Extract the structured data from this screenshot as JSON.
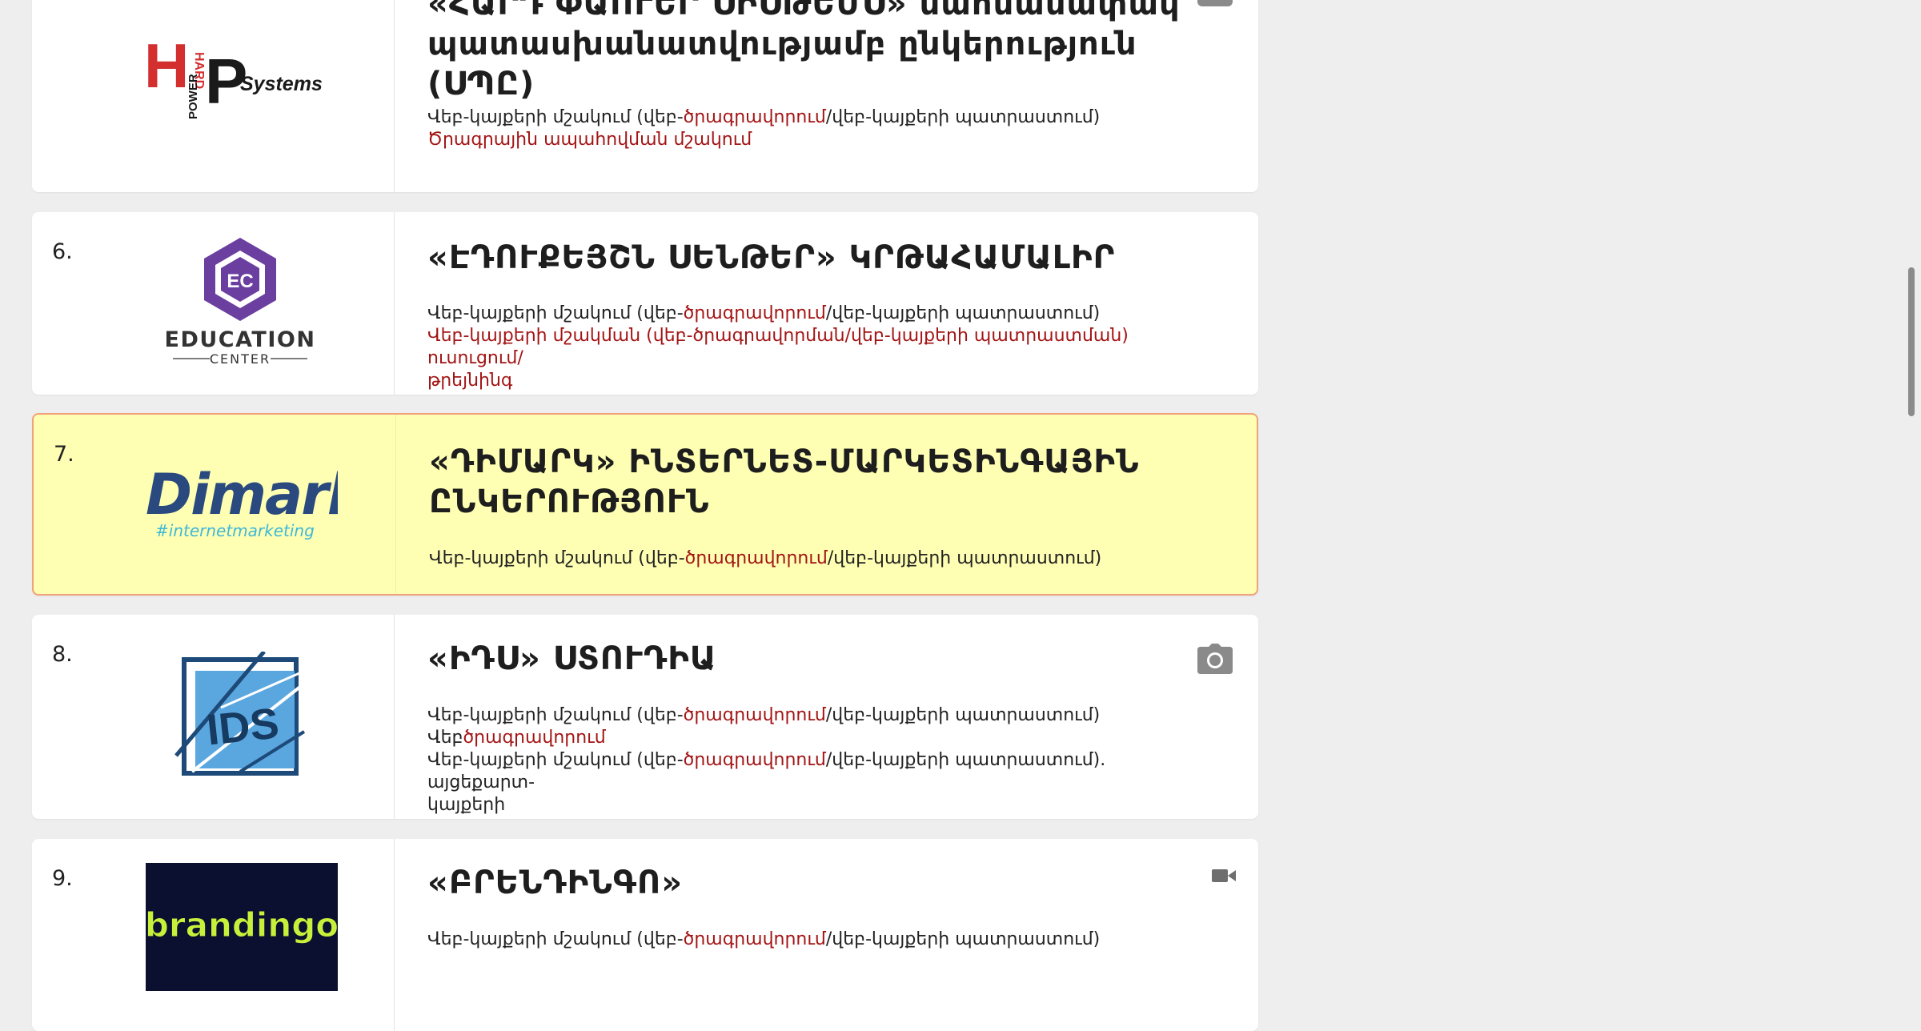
{
  "items": [
    {
      "title_lines": [
        "«ՀԱՐԴ ՓԱՈՒԵՐ ՍԻՍԹԵՄՍ» սահմանափակ",
        "պատասխանատվությամբ ընկերություն",
        "(ՍՊԸ)"
      ],
      "logo_text": {
        "h": "H",
        "hard": "HARD",
        "power": "POWER",
        "p": "P",
        "systems": "Systems"
      },
      "desc": {
        "l1a": "Վեբ-կայքերի մշակում (վեբ-",
        "l1b": "ծրագրավորում",
        "l1c": "/վեբ-կայքերի պատրաստում)",
        "l2": "Ծրագրային ապահովման մշակում"
      }
    },
    {
      "number": "6.",
      "title_lines": [
        "«ԷԴՈՒՔԵՅՇՆ ՍԵՆԹԵՐ» ԿՐԹԱՀԱՄԱԼԻՐ"
      ],
      "logo_text": {
        "ec": "EC",
        "education": "EDUCATION",
        "center": "CENTER"
      },
      "desc": {
        "l1a": "Վեբ-կայքերի մշակում (վեբ-",
        "l1b": "ծրագրավորում",
        "l1c": "/վեբ-կայքերի պատրաստում)",
        "l2": "Վեբ-կայքերի մշակման (վեբ-ծրագրավորման/վեբ-կայքերի պատրաստման) ուսուցում/",
        "l3": "թրեյնինգ"
      }
    },
    {
      "number": "7.",
      "title_lines": [
        "«ԴԻՄԱՐԿ» ԻՆՏԵՐՆԵՏ-ՄԱՐԿԵՏԻՆԳԱՅԻՆ",
        "ԸՆԿԵՐՈՒԹՅՈՒՆ"
      ],
      "logo_text": {
        "dimark": "Dimark",
        "tag": "#internetmarketing"
      },
      "desc": {
        "l1a": "Վեբ-կայքերի մշակում (վեբ-",
        "l1b": "ծրագրավորում",
        "l1c": "/վեբ-կայքերի պատրաստում)"
      }
    },
    {
      "number": "8.",
      "title_lines": [
        "«ԻԴՍ» ՍՏՈՒԴԻԱ"
      ],
      "logo_text": {
        "ids": "IDS"
      },
      "desc": {
        "l1a": "Վեբ-կայքերի մշակում (վեբ-",
        "l1b": "ծրագրավորում",
        "l1c": "/վեբ-կայքերի պատրաստում)",
        "l2a": "Վեբ",
        "l2b": "ծրագրավորում",
        "l3a": "Վեբ-կայքերի մշակում (վեբ-",
        "l3b": "ծրագրավորում",
        "l3c": "/վեբ-կայքերի պատրաստում). այցեքարտ-",
        "l4": "կայքերի"
      }
    },
    {
      "number": "9.",
      "title_lines": [
        "«ԲՐԵՆԴԻՆԳՈ»"
      ],
      "logo_text": {
        "brandingo": "brandingo"
      },
      "desc": {
        "l1a": "Վեբ-կայքերի մշակում (վեբ-",
        "l1b": "ծրագրավորում",
        "l1c": "/վեբ-կայքերի պատրաստում)"
      }
    }
  ],
  "icons": {
    "photo": "camera-icon",
    "video": "video-camera-icon"
  },
  "colors": {
    "accent_red": "#a31414",
    "highlight_bg": "#feffb3",
    "highlight_border": "#f0a27a",
    "icon_gray": "#8a8a8a"
  }
}
